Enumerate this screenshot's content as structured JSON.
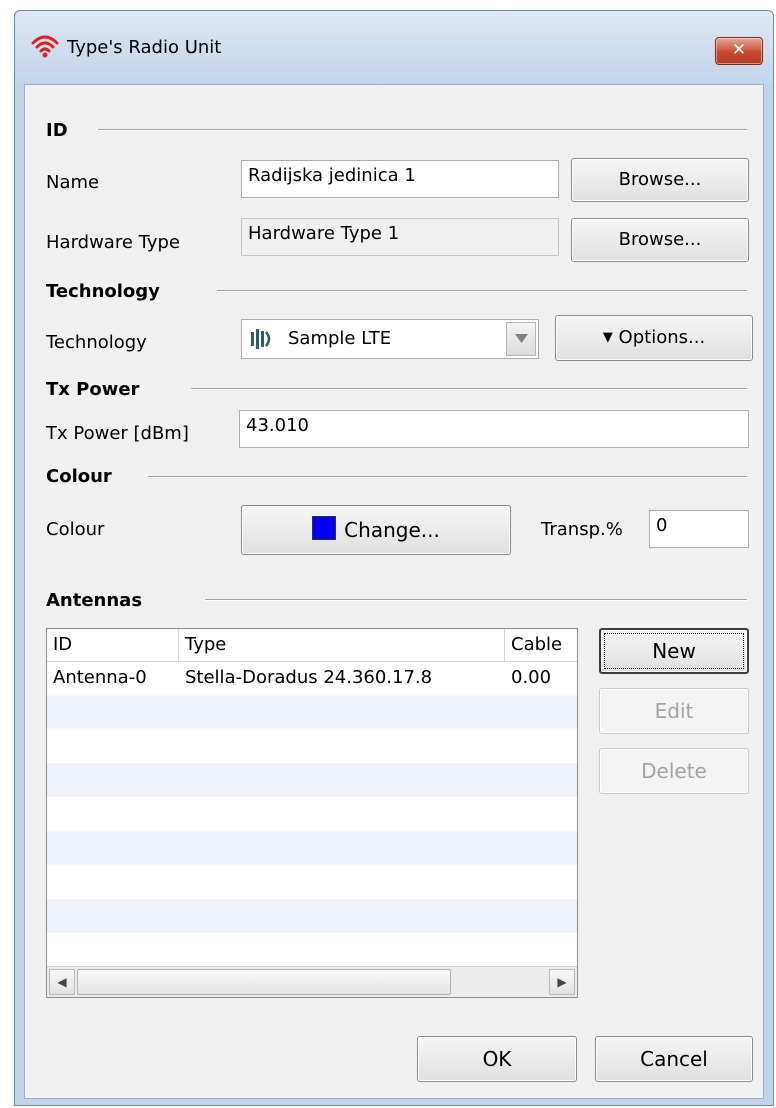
{
  "window": {
    "title": "Type's Radio Unit",
    "close_glyph": "✕"
  },
  "id_section": {
    "title": "ID",
    "name_label": "Name",
    "name_value": "Radijska jedinica 1",
    "name_browse": "Browse...",
    "hw_label": "Hardware Type",
    "hw_value": "Hardware Type 1",
    "hw_browse": "Browse..."
  },
  "technology_section": {
    "title": "Technology",
    "label": "Technology",
    "selected": "Sample LTE",
    "options_button": "Options...",
    "options_arrow": "▼"
  },
  "txpower_section": {
    "title": "Tx Power",
    "label": "Tx Power [dBm]",
    "value": "43.010"
  },
  "colour_section": {
    "title": "Colour",
    "label": "Colour",
    "change_button": "Change...",
    "swatch_color": "#0000ff",
    "transp_label": "Transp.%",
    "transp_value": "0"
  },
  "antennas_section": {
    "title": "Antennas",
    "columns": [
      "ID",
      "Type",
      "Cable"
    ],
    "rows": [
      {
        "id": "Antenna-0",
        "type": "Stella-Doradus 24.360.17.8",
        "cable": "0.00"
      }
    ],
    "new_button": "New",
    "edit_button": "Edit",
    "delete_button": "Delete",
    "scroll_left": "◀",
    "scroll_right": "▶"
  },
  "footer": {
    "ok": "OK",
    "cancel": "Cancel"
  }
}
